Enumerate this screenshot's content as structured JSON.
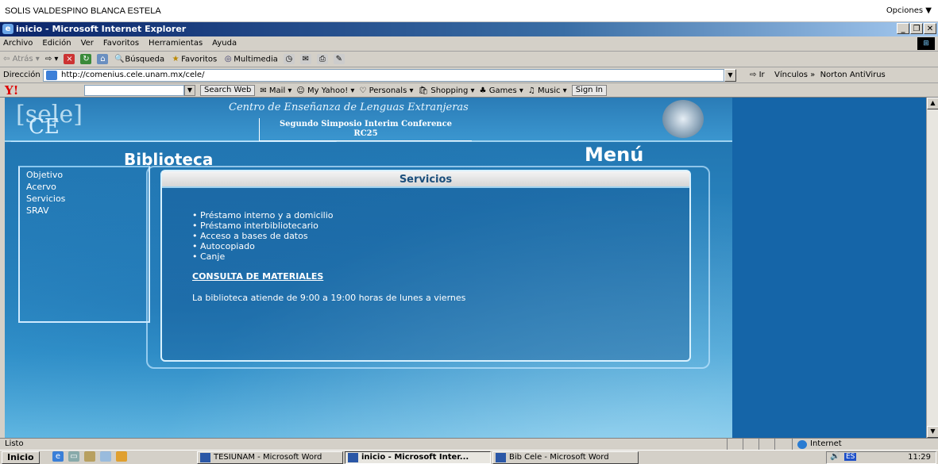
{
  "user_bar": {
    "name": "SOLIS VALDESPINO BLANCA ESTELA",
    "options": "Opciones ▼"
  },
  "window": {
    "title": "inicio - Microsoft Internet Explorer"
  },
  "menu": [
    "Archivo",
    "Edición",
    "Ver",
    "Favoritos",
    "Herramientas",
    "Ayuda"
  ],
  "toolbar": {
    "back": "Atrás",
    "search": "Búsqueda",
    "favorites": "Favoritos",
    "multimedia": "Multimedia"
  },
  "address": {
    "label": "Dirección",
    "url": "http://comenius.cele.unam.mx/cele/",
    "go": "Ir",
    "links": "Vínculos »",
    "norton": "Norton AntiVirus"
  },
  "yahoo": {
    "logo": "Y!",
    "search_web": "Search Web",
    "mail": "Mail",
    "my_yahoo": "My Yahoo!",
    "personals": "Personals",
    "shopping": "Shopping",
    "games": "Games",
    "music": "Music",
    "sign_in": "Sign In"
  },
  "page": {
    "logo_top": "[sele]",
    "logo_bottom": "CE",
    "title": "Centro de Enseñanza de Lenguas Extranjeras",
    "event_line1": "Segundo Simposio Interim Conference",
    "event_line2": "RC25",
    "section_left": "Biblioteca",
    "section_right": "Menú",
    "nav": [
      "Objetivo",
      "Acervo",
      "Servicios",
      "SRAV"
    ],
    "panel_title": "Servicios",
    "services": [
      "Préstamo interno y a domicilio",
      "Préstamo interbibliotecario",
      "Acceso a bases de datos",
      "Autocopiado",
      "Canje"
    ],
    "consult": "CONSULTA DE MATERIALES",
    "hours": "La biblioteca atiende de 9:00 a 19:00 horas de lunes a viernes"
  },
  "status": {
    "text": "Listo",
    "zone": "Internet"
  },
  "taskbar": {
    "start": "Inicio",
    "tasks": [
      "TESIUNAM - Microsoft Word",
      "inicio - Microsoft Inter...",
      "Bib Cele - Microsoft Word"
    ],
    "lang": "ES",
    "clock": "11:29"
  }
}
